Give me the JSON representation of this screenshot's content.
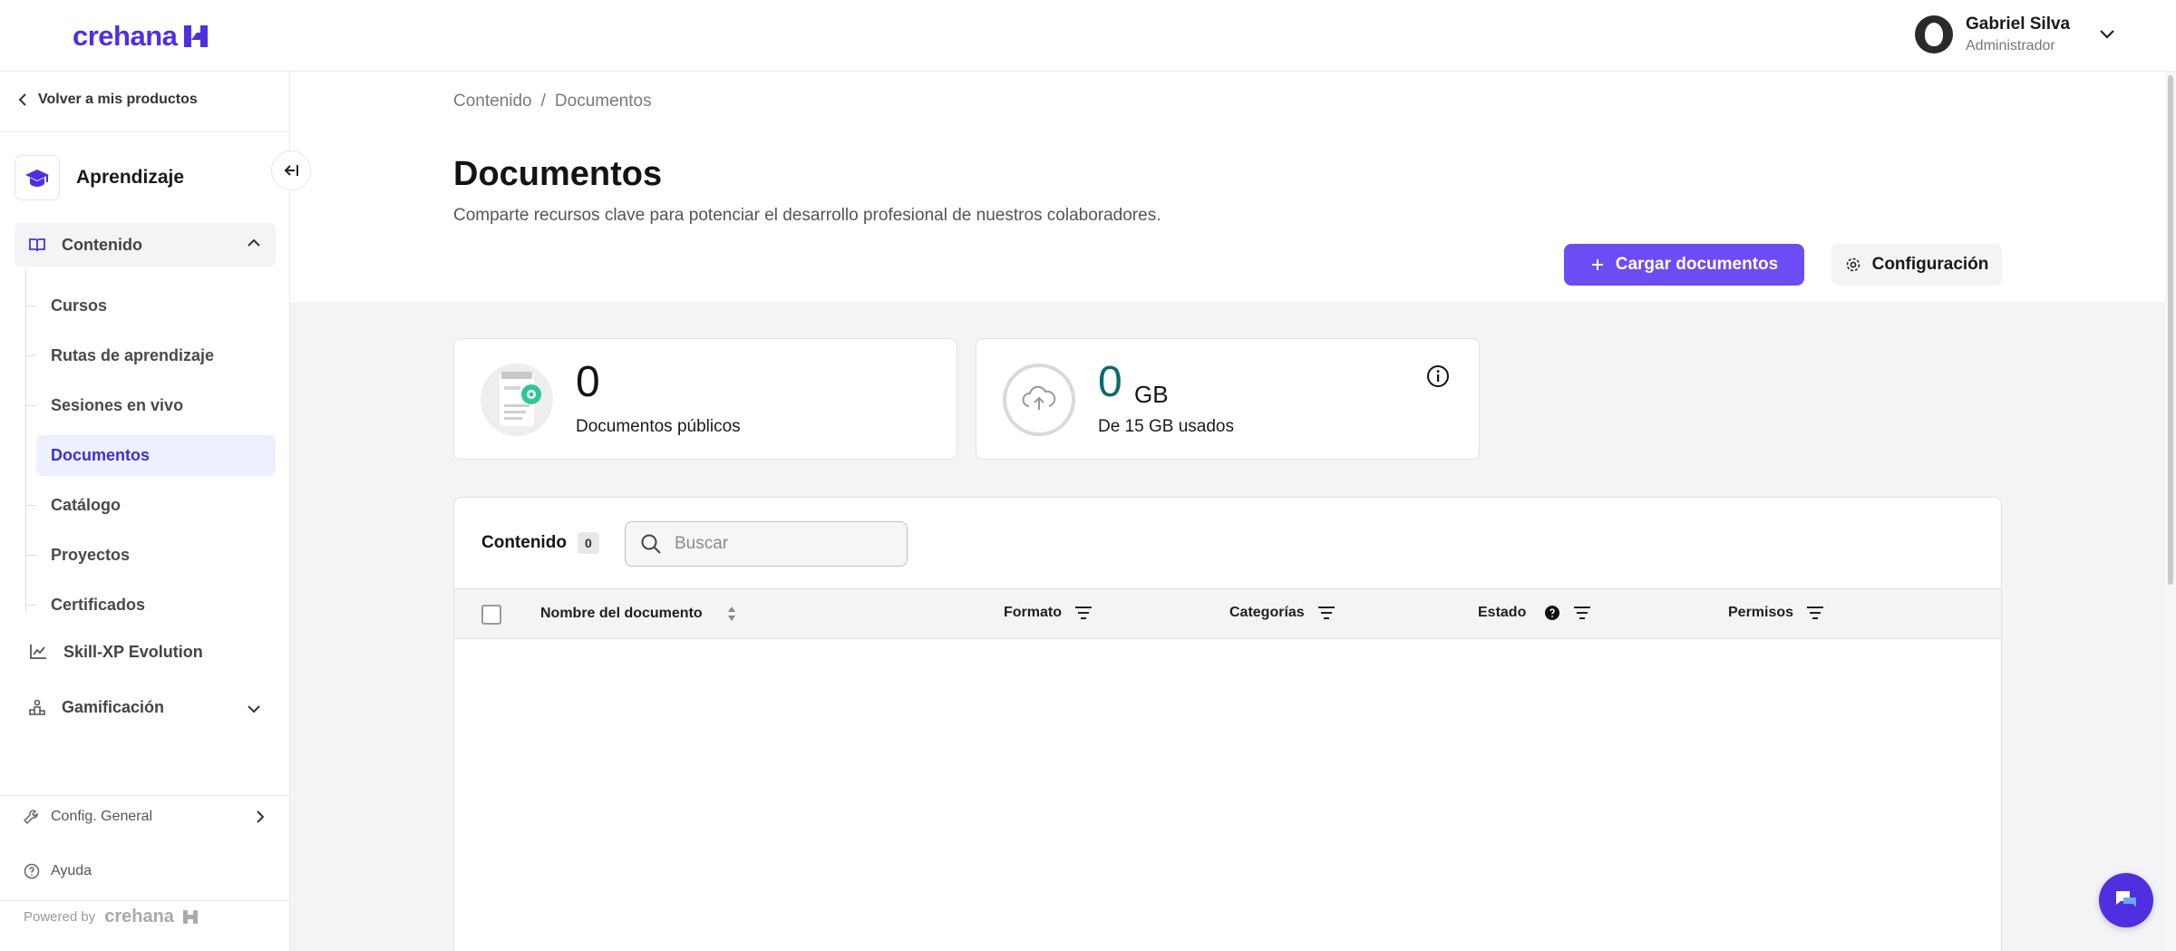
{
  "brand": {
    "name": "crehana",
    "accent": "#4f2fe0",
    "primary_button": "#6c4cf5"
  },
  "user": {
    "name": "Gabriel Silva",
    "role": "Administrador"
  },
  "sidebar": {
    "back_label": "Volver a mis productos",
    "module_title": "Aprendizaje",
    "content_section": "Contenido",
    "items": [
      {
        "label": "Cursos"
      },
      {
        "label": "Rutas de aprendizaje"
      },
      {
        "label": "Sesiones en vivo"
      },
      {
        "label": "Documentos"
      },
      {
        "label": "Catálogo"
      },
      {
        "label": "Proyectos"
      },
      {
        "label": "Certificados"
      }
    ],
    "skill_label": "Skill-XP Evolution",
    "gamification_label": "Gamificación",
    "config_label": "Config. General",
    "help_label": "Ayuda",
    "powered_label": "Powered by",
    "powered_brand": "crehana"
  },
  "breadcrumb": {
    "root": "Contenido",
    "sep": "/",
    "current": "Documentos"
  },
  "page": {
    "title": "Documentos",
    "subtitle": "Comparte recursos clave para potenciar el desarrollo profesional de nuestros colaboradores.",
    "upload_button": "Cargar documentos",
    "config_button": "Configuración"
  },
  "stats": {
    "public_docs": {
      "value": "0",
      "label": "Documentos públicos"
    },
    "storage": {
      "value": "0",
      "unit": "GB",
      "label": "De 15 GB usados"
    }
  },
  "table": {
    "title": "Contenido",
    "count": "0",
    "search_placeholder": "Buscar",
    "columns": [
      "Nombre del documento",
      "Formato",
      "Categorías",
      "Estado",
      "Permisos"
    ]
  }
}
